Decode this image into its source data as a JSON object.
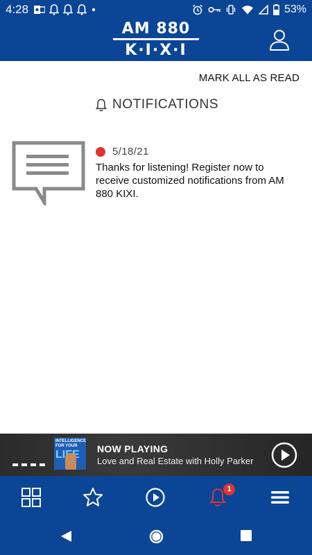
{
  "status_bar": {
    "time": "4:28",
    "battery": "53%",
    "left_icons": [
      "outlook-notification-icon",
      "bell-notification-icon",
      "bell-notification-icon",
      "bell-notification-icon",
      "dot-icon"
    ],
    "right_icons": [
      "alarm-icon",
      "key-icon",
      "vibrate-icon",
      "wifi-icon",
      "signal-icon",
      "battery-icon"
    ]
  },
  "header": {
    "logo_line1": "AM 880",
    "logo_line2": "K·I·X·I",
    "account_icon": "person-icon"
  },
  "actions": {
    "mark_all_read": "MARK ALL AS READ"
  },
  "notifications": {
    "heading": "NOTIFICATIONS",
    "items": [
      {
        "date": "5/18/21",
        "unread": true,
        "message": "Thanks for listening! Register now to receive customized notifications from AM 880 KIXI."
      }
    ]
  },
  "now_playing": {
    "label": "NOW PLAYING",
    "title": "Love and Real Estate with Holly Parker",
    "art_text_top": "INTELLIGENCE FOR YOUR",
    "art_text_big": "LIFE"
  },
  "tabs": [
    {
      "name": "grid-icon"
    },
    {
      "name": "star-icon"
    },
    {
      "name": "play-circle-icon"
    },
    {
      "name": "bell-icon",
      "badge": "1"
    },
    {
      "name": "menu-icon"
    }
  ],
  "colors": {
    "brand_blue": "#0b4596",
    "unread_red": "#e03334",
    "active_tab": "#e03334"
  }
}
